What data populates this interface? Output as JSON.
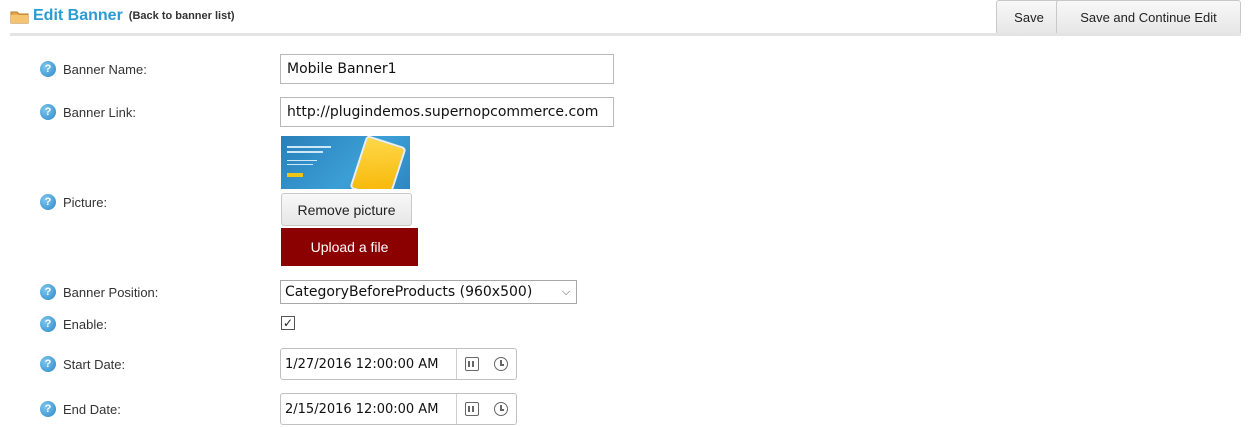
{
  "header": {
    "title": "Edit Banner",
    "back_link": "(Back to banner list)",
    "save_label": "Save",
    "save_continue_label": "Save and Continue Edit"
  },
  "form": {
    "banner_name": {
      "label": "Banner Name:",
      "value": "Mobile Banner1"
    },
    "banner_link": {
      "label": "Banner Link:",
      "value": "http://plugindemos.supernopcommerce.com"
    },
    "picture": {
      "label": "Picture:",
      "remove_label": "Remove picture",
      "upload_label": "Upload a file"
    },
    "banner_position": {
      "label": "Banner Position:",
      "selected": "CategoryBeforeProducts (960x500)"
    },
    "enable": {
      "label": "Enable:",
      "checked": true
    },
    "start_date": {
      "label": "Start Date:",
      "value": "1/27/2016 12:00:00 AM"
    },
    "end_date": {
      "label": "End Date:",
      "value": "2/15/2016 12:00:00 AM"
    }
  },
  "colors": {
    "title": "#2b9bd6",
    "upload_button": "#8b0000",
    "help_icon": "#2b88c8"
  },
  "icons": {
    "help": "?",
    "chevron": "⌵",
    "check": "✓"
  }
}
